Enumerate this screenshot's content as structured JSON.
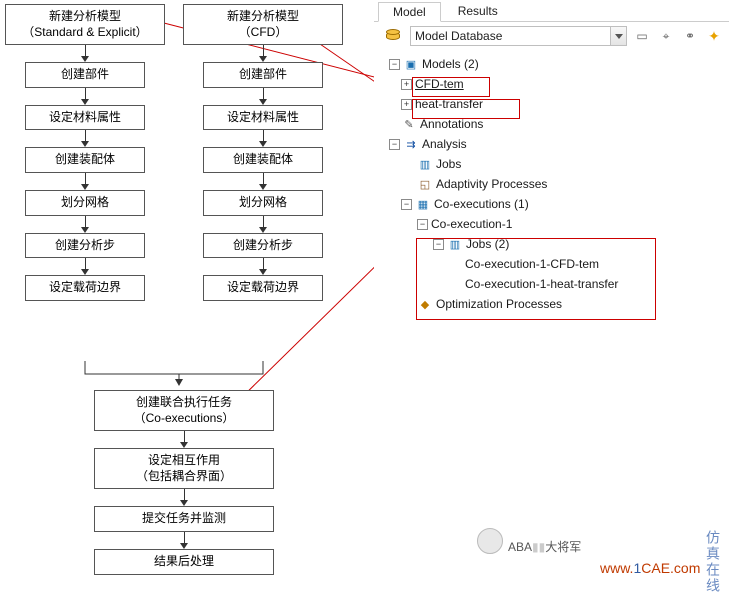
{
  "flow": {
    "colA": {
      "start": "新建分析模型\n（Standard & Explicit）",
      "steps": [
        "创建部件",
        "设定材料属性",
        "创建装配体",
        "划分网格",
        "创建分析步",
        "设定载荷边界"
      ]
    },
    "colB": {
      "start": "新建分析模型\n（CFD）",
      "steps": [
        "创建部件",
        "设定材料属性",
        "创建装配体",
        "划分网格",
        "创建分析步",
        "设定载荷边界"
      ]
    },
    "merge": [
      "创建联合执行任务\n（Co-executions）",
      "设定相互作用\n（包括耦合界面）",
      "提交任务并监测",
      "结果后处理"
    ]
  },
  "panel": {
    "tabs": {
      "model": "Model",
      "results": "Results"
    },
    "combo": {
      "label": "Model Database"
    },
    "toolbar_icons": [
      "set-path",
      "filter",
      "link",
      "tips"
    ],
    "tree": {
      "models_label": "Models (2)",
      "model1": "CFD-tem",
      "model2": "heat-transfer",
      "annotations": "Annotations",
      "analysis": "Analysis",
      "jobs": "Jobs",
      "adaptivity": "Adaptivity Processes",
      "coexec_root": "Co-executions (1)",
      "coexec1": "Co-execution-1",
      "coexec_jobs": "Jobs (2)",
      "coexec_job1": "Co-execution-1-CFD-tem",
      "coexec_job2": "Co-execution-1-heat-transfer",
      "opt": "Optimization Processes"
    }
  },
  "watermarks": {
    "wechat_label": "ABA",
    "wechat_suffix": "大将军",
    "site_prefix": "www.",
    "site_mid1": "1",
    "site_mid2": "CAE",
    "site_suffix": ".com",
    "side": "仿真在线"
  }
}
